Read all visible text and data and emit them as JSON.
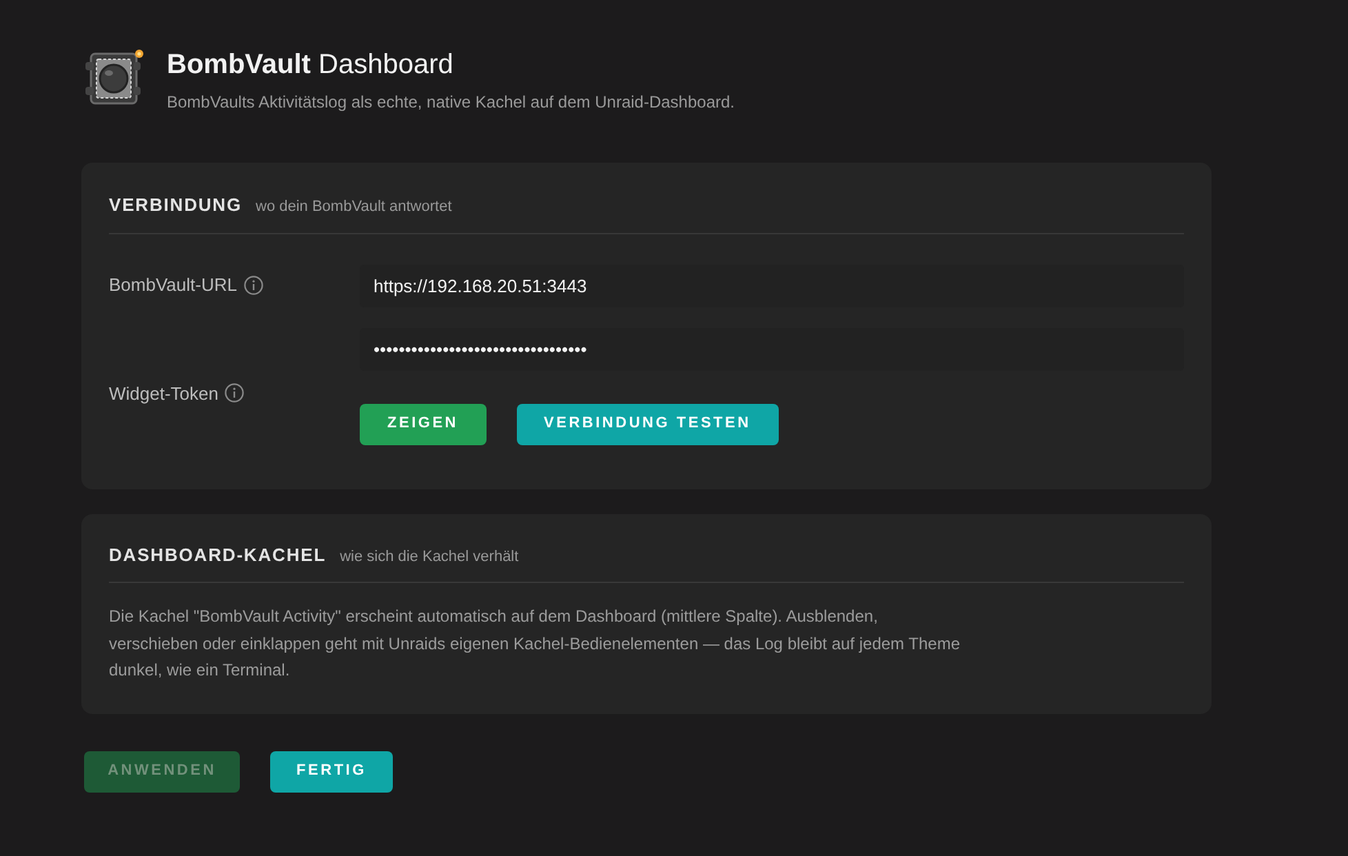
{
  "header": {
    "title": "**BombVault** Dashboard",
    "subtitle": "BombVaults Aktivitätslog als echte, native Kachel auf dem Unraid-Dashboard."
  },
  "sections": [
    {
      "kind": "form",
      "heading": "VERBINDUNG",
      "hint": "wo dein BombVault antwortet",
      "fields": [
        {
          "label": "BombVault-URL",
          "value": "https://192.168.20.51:3443"
        },
        {
          "label": "Widget-Token",
          "value": "••••••••••••••••••••••••••••••••••",
          "buttons": [
            {
              "label": "ZEIGEN",
              "kind": "success"
            },
            {
              "label": "VERBINDUNG TESTEN",
              "kind": "accent"
            }
          ]
        }
      ]
    },
    {
      "kind": "text",
      "heading": "DASHBOARD-KACHEL",
      "hint": "wie sich die Kachel verhält",
      "body_lines": [
        "Die Kachel \"BombVault Activity\" erscheint automatisch auf dem Dashboard (mittlere Spalte). Ausblenden,",
        "verschieben oder einklappen geht mit Unraids eigenen Kachel-Bedienelementen — das Log bleibt auf jedem Theme",
        "dunkel, wie ein Terminal."
      ]
    }
  ],
  "actions": [
    {
      "label": "ANWENDEN",
      "kind": "success",
      "disabled": true
    },
    {
      "label": "FERTIG",
      "kind": "accent",
      "disabled": false
    }
  ]
}
